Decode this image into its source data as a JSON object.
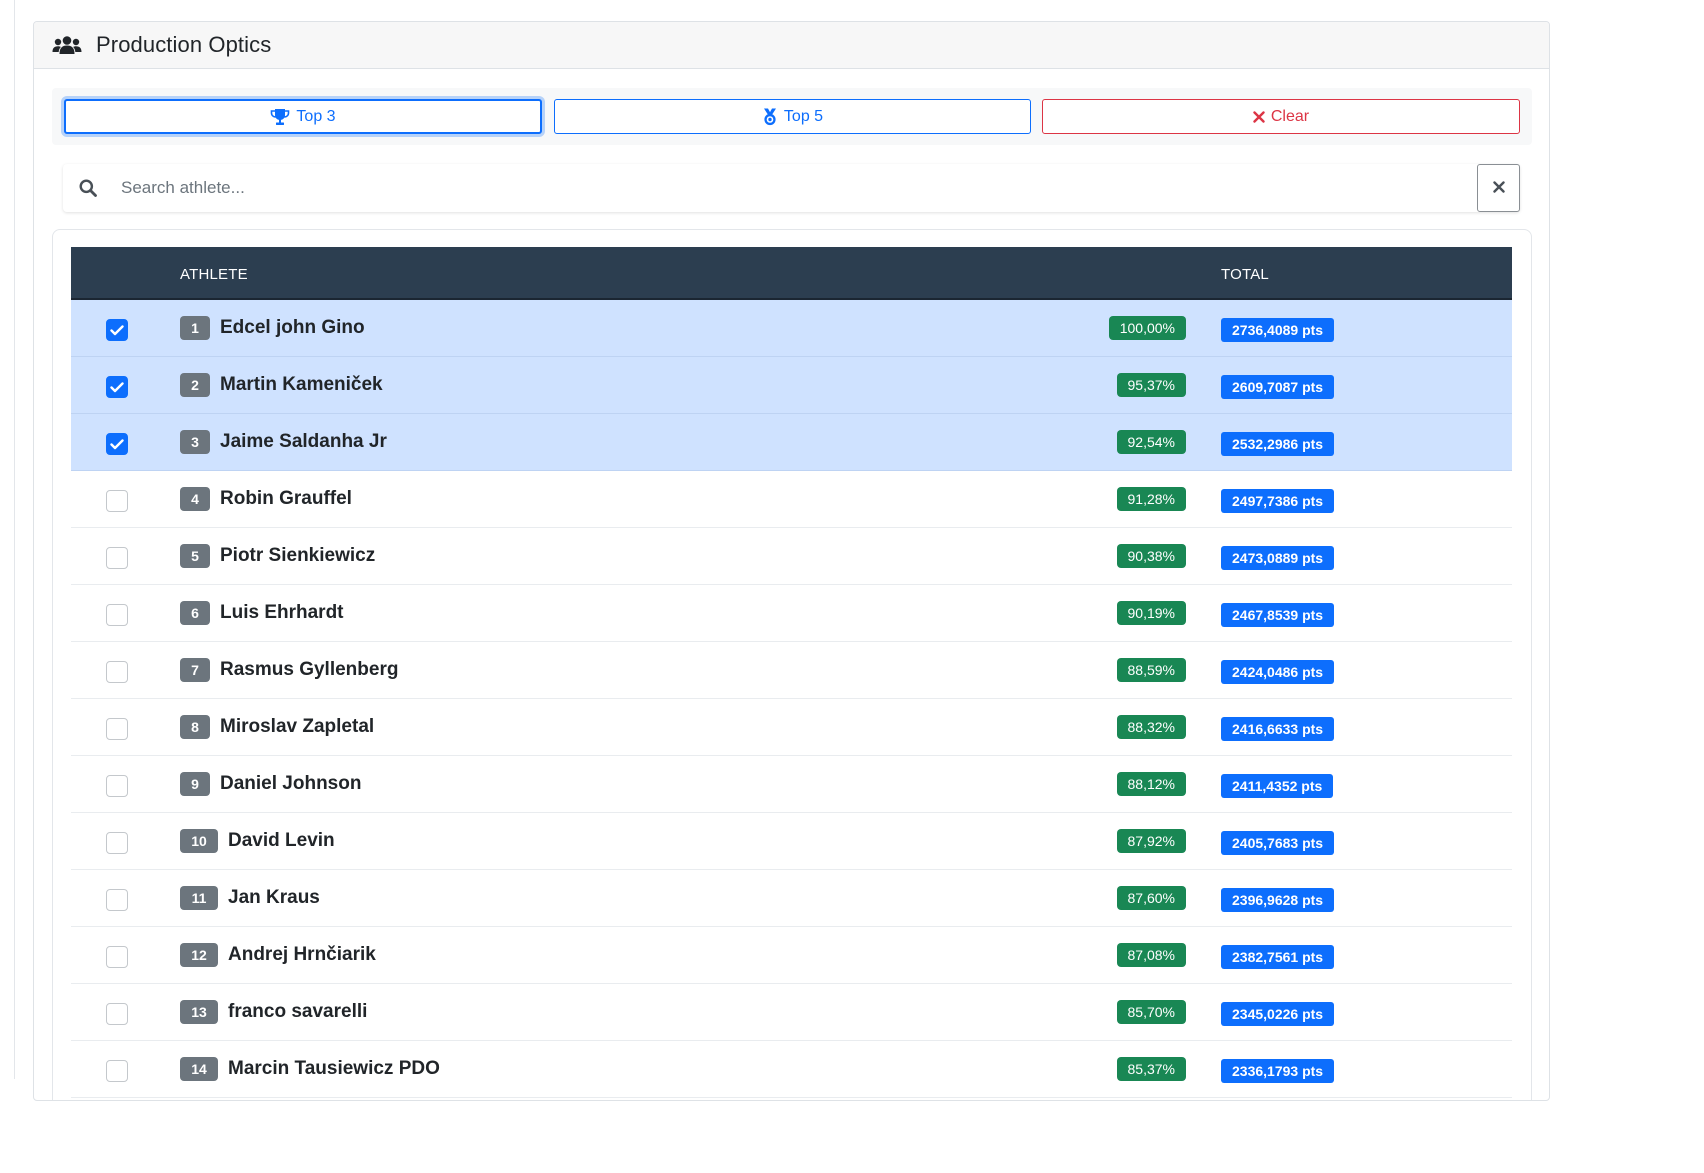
{
  "card": {
    "title": "Production Optics",
    "icon": "users-icon"
  },
  "buttons": {
    "top3": {
      "label": "Top 3",
      "icon": "trophy-icon"
    },
    "top5": {
      "label": "Top 5",
      "icon": "medal-icon"
    },
    "clear": {
      "label": "Clear",
      "icon": "x-icon"
    }
  },
  "search": {
    "placeholder": "Search athlete...",
    "value": ""
  },
  "table": {
    "headers": {
      "athlete": "ATHLETE",
      "total": "TOTAL"
    },
    "rows": [
      {
        "checked": true,
        "rank": "1",
        "name": "Edcel john Gino",
        "percent": "100,00%",
        "total": "2736,4089 pts"
      },
      {
        "checked": true,
        "rank": "2",
        "name": "Martin Kameniček",
        "percent": "95,37%",
        "total": "2609,7087 pts"
      },
      {
        "checked": true,
        "rank": "3",
        "name": "Jaime Saldanha Jr",
        "percent": "92,54%",
        "total": "2532,2986 pts"
      },
      {
        "checked": false,
        "rank": "4",
        "name": "Robin Grauffel",
        "percent": "91,28%",
        "total": "2497,7386 pts"
      },
      {
        "checked": false,
        "rank": "5",
        "name": "Piotr Sienkiewicz",
        "percent": "90,38%",
        "total": "2473,0889 pts"
      },
      {
        "checked": false,
        "rank": "6",
        "name": "Luis Ehrhardt",
        "percent": "90,19%",
        "total": "2467,8539 pts"
      },
      {
        "checked": false,
        "rank": "7",
        "name": "Rasmus Gyllenberg",
        "percent": "88,59%",
        "total": "2424,0486 pts"
      },
      {
        "checked": false,
        "rank": "8",
        "name": "Miroslav Zapletal",
        "percent": "88,32%",
        "total": "2416,6633 pts"
      },
      {
        "checked": false,
        "rank": "9",
        "name": "Daniel Johnson",
        "percent": "88,12%",
        "total": "2411,4352 pts"
      },
      {
        "checked": false,
        "rank": "10",
        "name": "David Levin",
        "percent": "87,92%",
        "total": "2405,7683 pts"
      },
      {
        "checked": false,
        "rank": "11",
        "name": "Jan Kraus",
        "percent": "87,60%",
        "total": "2396,9628 pts"
      },
      {
        "checked": false,
        "rank": "12",
        "name": "Andrej Hrnčiarik",
        "percent": "87,08%",
        "total": "2382,7561 pts"
      },
      {
        "checked": false,
        "rank": "13",
        "name": "franco savarelli",
        "percent": "85,70%",
        "total": "2345,0226 pts"
      },
      {
        "checked": false,
        "rank": "14",
        "name": "Marcin Tausiewicz PDO",
        "percent": "85,37%",
        "total": "2336,1793 pts"
      }
    ]
  },
  "colors": {
    "header_bg": "#2c3e50",
    "selected_row": "#cfe2ff",
    "primary": "#0d6efd",
    "danger": "#dc3545",
    "success": "#198754",
    "rank_badge": "#6c757d"
  }
}
